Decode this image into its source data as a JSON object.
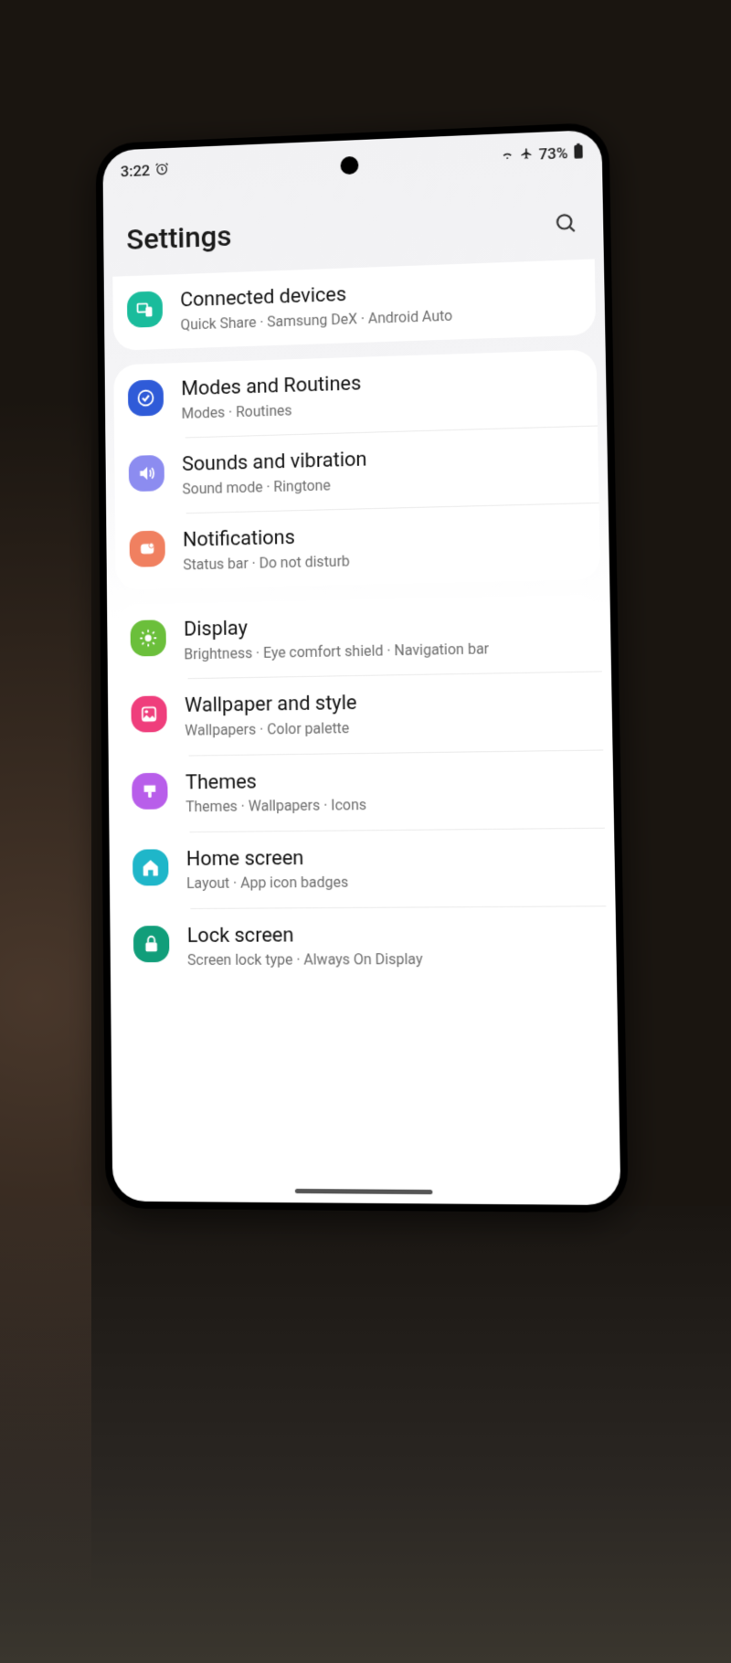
{
  "status": {
    "time": "3:22",
    "battery": "73%"
  },
  "page": {
    "title": "Settings"
  },
  "groups": [
    {
      "items": [
        {
          "id": "connected",
          "icon_color": "#1abc9c",
          "icon": "devices",
          "title": "Connected devices",
          "sub": "Quick Share  ·  Samsung DeX  ·  Android Auto"
        }
      ]
    },
    {
      "items": [
        {
          "id": "modes",
          "icon_color": "#2f5bd8",
          "icon": "check",
          "title": "Modes and Routines",
          "sub": "Modes  ·  Routines"
        },
        {
          "id": "sounds",
          "icon_color": "#8c8cf0",
          "icon": "volume",
          "title": "Sounds and vibration",
          "sub": "Sound mode  ·  Ringtone"
        },
        {
          "id": "notifications",
          "icon_color": "#f08060",
          "icon": "bell",
          "title": "Notifications",
          "sub": "Status bar  ·  Do not disturb"
        }
      ]
    },
    {
      "items": [
        {
          "id": "display",
          "icon_color": "#6bbf3b",
          "icon": "sun",
          "title": "Display",
          "sub": "Brightness  ·  Eye comfort shield  ·  Navigation bar"
        },
        {
          "id": "wallpaper",
          "icon_color": "#ef3e7c",
          "icon": "image",
          "title": "Wallpaper and style",
          "sub": "Wallpapers  ·  Color palette"
        },
        {
          "id": "themes",
          "icon_color": "#b85eea",
          "icon": "brush",
          "title": "Themes",
          "sub": "Themes  ·  Wallpapers  ·  Icons"
        },
        {
          "id": "home",
          "icon_color": "#1fb6c9",
          "icon": "home",
          "title": "Home screen",
          "sub": "Layout  ·  App icon badges"
        },
        {
          "id": "lock",
          "icon_color": "#119e7a",
          "icon": "lock",
          "title": "Lock screen",
          "sub": "Screen lock type  ·  Always On Display"
        }
      ]
    }
  ]
}
